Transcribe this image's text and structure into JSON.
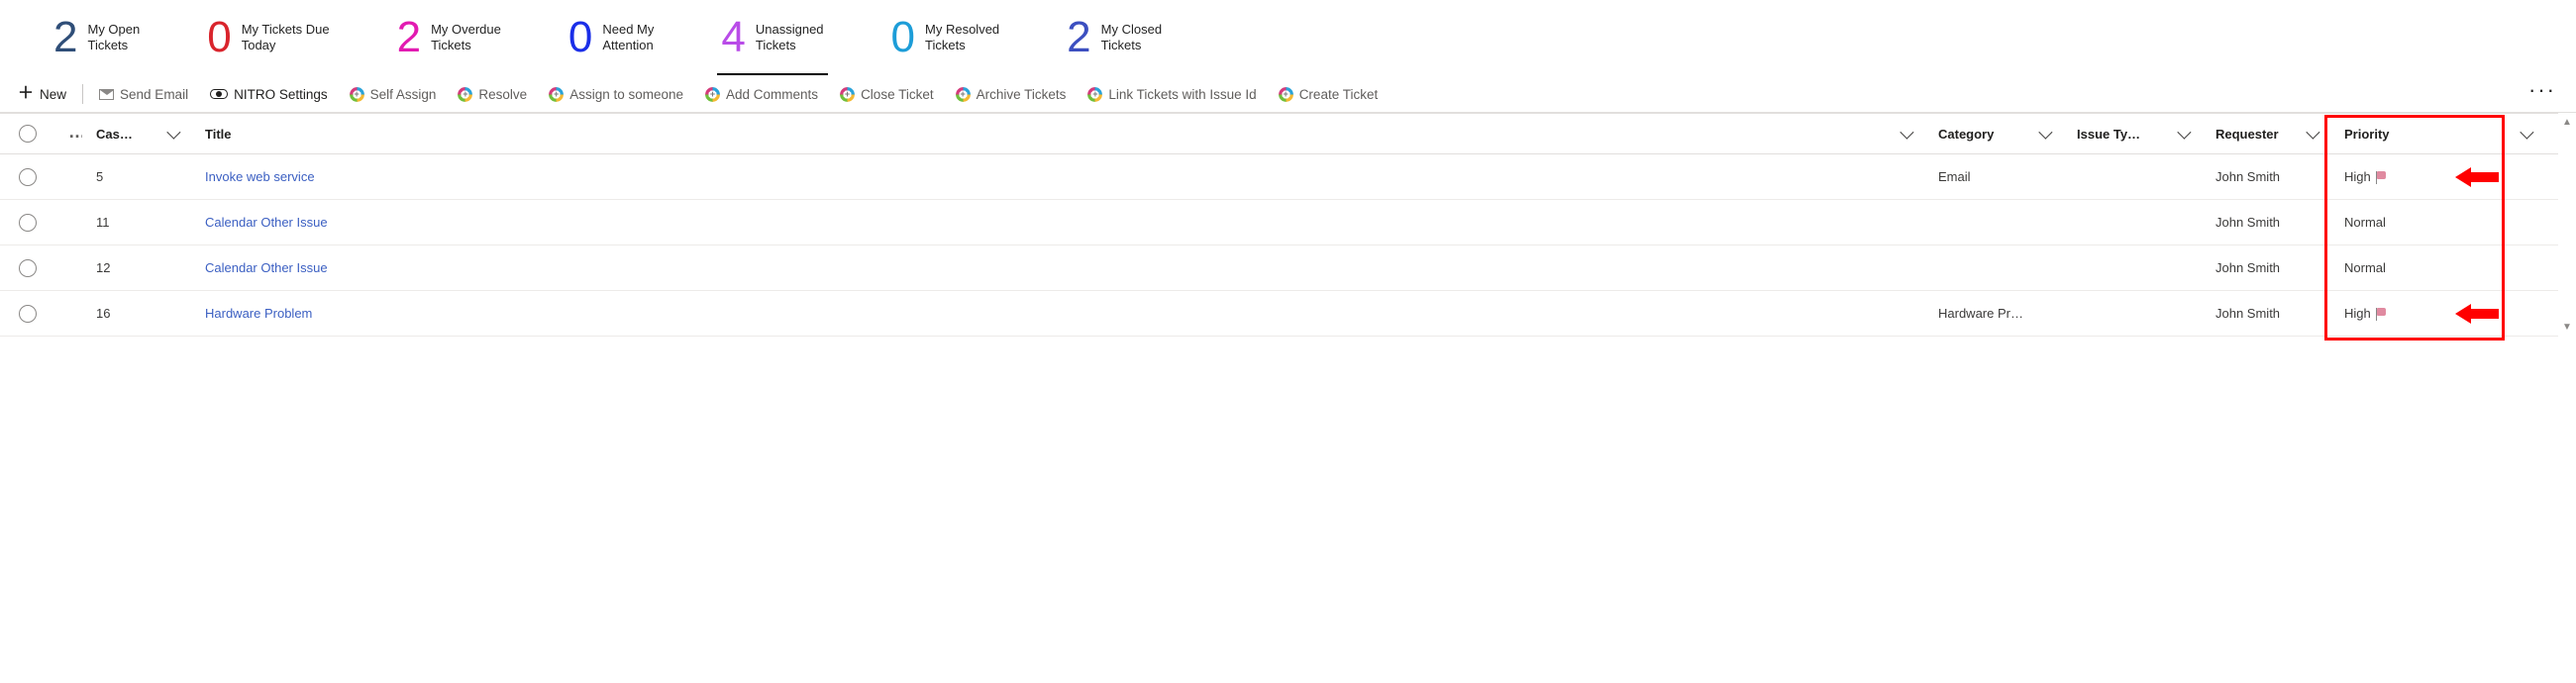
{
  "stats": [
    {
      "count": "2",
      "line1": "My Open",
      "line2": "Tickets",
      "color": "#2f4e78",
      "active": false
    },
    {
      "count": "0",
      "line1": "My Tickets Due",
      "line2": "Today",
      "color": "#d9242c",
      "active": false
    },
    {
      "count": "2",
      "line1": "My Overdue",
      "line2": "Tickets",
      "color": "#e21bb1",
      "active": false
    },
    {
      "count": "0",
      "line1": "Need My",
      "line2": "Attention",
      "color": "#1a2ee8",
      "active": false
    },
    {
      "count": "4",
      "line1": "Unassigned",
      "line2": "Tickets",
      "color": "#b94ce8",
      "active": true
    },
    {
      "count": "0",
      "line1": "My Resolved",
      "line2": "Tickets",
      "color": "#1d9dd8",
      "active": false
    },
    {
      "count": "2",
      "line1": "My Closed",
      "line2": "Tickets",
      "color": "#3c4fc0",
      "active": false
    }
  ],
  "actions": {
    "new": "New",
    "send_email": "Send Email",
    "nitro": "NITRO Settings",
    "self_assign": "Self Assign",
    "resolve": "Resolve",
    "assign_someone": "Assign to someone",
    "add_comments": "Add Comments",
    "close_ticket": "Close Ticket",
    "archive": "Archive Tickets",
    "link_issue": "Link Tickets with Issue Id",
    "create_ticket": "Create Ticket"
  },
  "columns": {
    "case": "Cas…",
    "title": "Title",
    "category": "Category",
    "issue_type": "Issue Ty…",
    "requester": "Requester",
    "priority": "Priority"
  },
  "rows": [
    {
      "case": "5",
      "title": "Invoke web service",
      "category": "Email",
      "issue_type": "",
      "requester": "John Smith",
      "priority": "High",
      "flag": true
    },
    {
      "case": "11",
      "title": "Calendar Other Issue",
      "category": "",
      "issue_type": "",
      "requester": "John Smith",
      "priority": "Normal",
      "flag": false
    },
    {
      "case": "12",
      "title": "Calendar Other Issue",
      "category": "",
      "issue_type": "",
      "requester": "John Smith",
      "priority": "Normal",
      "flag": false
    },
    {
      "case": "16",
      "title": "Hardware Problem",
      "category": "Hardware Pr…",
      "issue_type": "",
      "requester": "John Smith",
      "priority": "High",
      "flag": true
    }
  ]
}
